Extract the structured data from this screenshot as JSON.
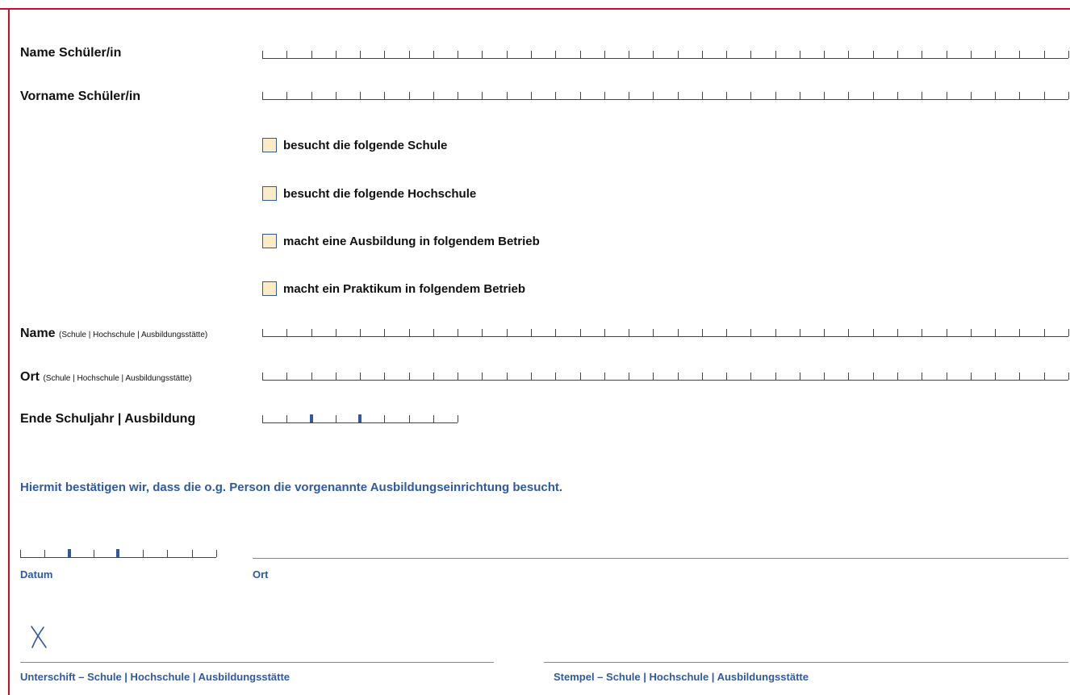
{
  "fields": {
    "name": "Name Schüler/in",
    "vorname": "Vorname Schüler/in",
    "inst_name": "Name",
    "inst_name_note": "(Schule | Hochschule | Ausbildungsstätte)",
    "inst_ort": "Ort",
    "inst_ort_note": "(Schule | Hochschule | Ausbildungsstätte)",
    "end_year": "Ende Schuljahr | Ausbildung"
  },
  "options": [
    {
      "label": "besucht die folgende Schule"
    },
    {
      "label": "besucht die folgende Hochschule"
    },
    {
      "label": "macht eine Ausbildung in folgendem Betrieb"
    },
    {
      "label": "macht ein Praktikum in folgendem Betrieb"
    }
  ],
  "confirmation": "Hiermit bestätigen wir, dass die o.g. Person die vorgenannte Ausbildungseinrichtung besucht.",
  "footer": {
    "datum": "Datum",
    "ort": "Ort",
    "unterschrift": "Unterschift – Schule | Hochschule | Ausbildungsstätte",
    "stempel": "Stempel – Schule | Hochschule | Ausbildungsstätte"
  },
  "icons": {
    "signature_mark": "signature-x-icon"
  },
  "colors": {
    "frame": "#c8102e",
    "accent_blue": "#2f5aa3",
    "checkbox_fill": "#fbecc6"
  }
}
